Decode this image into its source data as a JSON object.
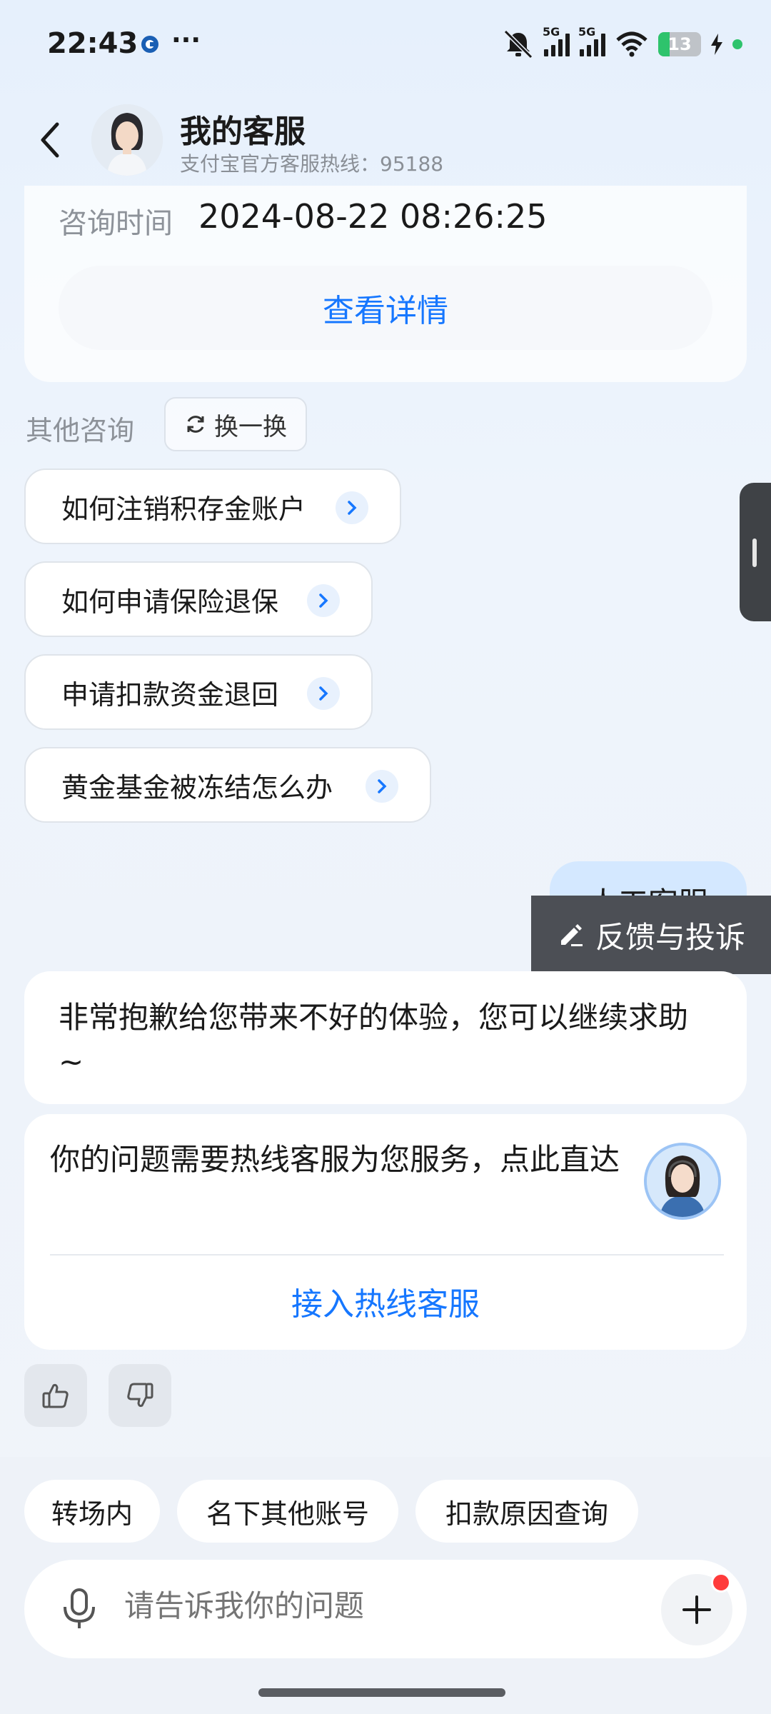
{
  "status_bar": {
    "time": "22:43",
    "dots": "···",
    "net1": "5G",
    "net2": "5G",
    "wifi_sub": "6",
    "battery": "13"
  },
  "header": {
    "title": "我的客服",
    "subtitle": "支付宝官方客服热线：95188"
  },
  "consult_card": {
    "time_label": "咨询时间",
    "time_value": "2024-08-22 08:26:25",
    "detail_button": "查看详情"
  },
  "other_consult": {
    "label": "其他咨询",
    "switch_label": "换一换",
    "items": [
      "如何注销积存金账户",
      "如何申请保险退保",
      "申请扣款资金退回",
      "黄金基金被冻结怎么办"
    ]
  },
  "chat": {
    "user_message": "人工客服",
    "feedback_label": "反馈与投诉",
    "bot_reply": "非常抱歉给您带来不好的体验，您可以继续求助~",
    "hotline_text": "你的问题需要热线客服为您服务，点此直达",
    "hotline_link": "接入热线客服"
  },
  "quick_actions": [
    "转场内",
    "名下其他账号",
    "扣款原因查询"
  ],
  "input": {
    "placeholder": "请告诉我你的问题"
  },
  "colors": {
    "accent": "#1677ff",
    "user_bubble": "#d4e8ff",
    "feedback_bg": "#4c4f55"
  }
}
